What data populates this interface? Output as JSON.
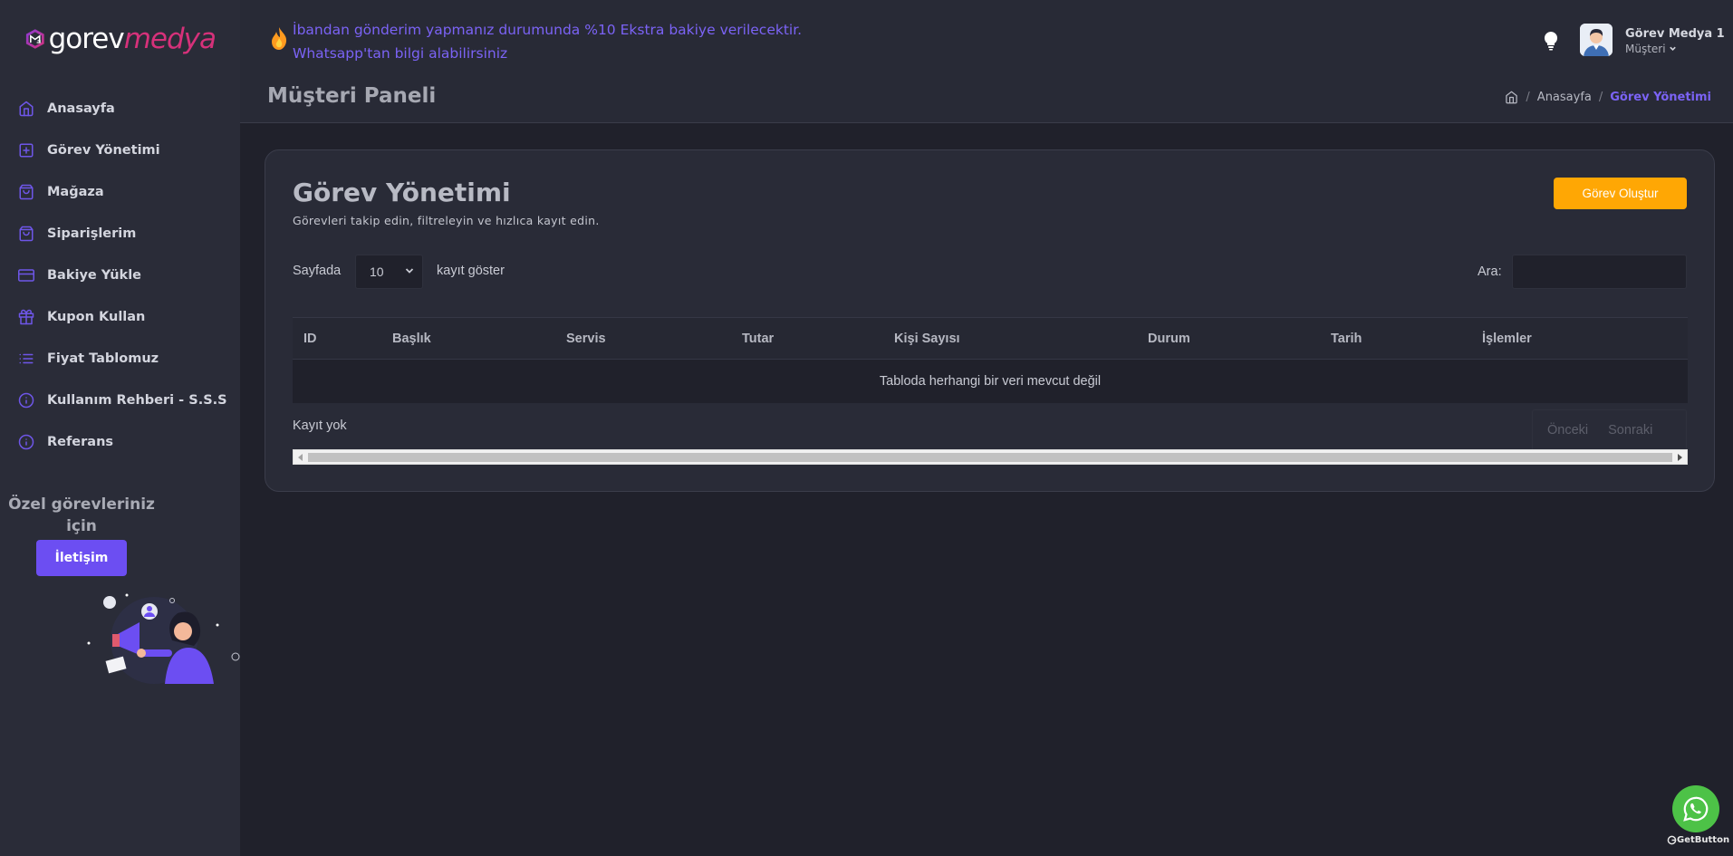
{
  "brand": {
    "logo_part1": "gorev",
    "logo_part2": "medya",
    "accent": "#7b63f5",
    "orange": "#ffa704"
  },
  "sidebar": {
    "items": [
      {
        "label": "Anasayfa",
        "icon": "home-icon"
      },
      {
        "label": "Görev Yönetimi",
        "icon": "plus-square-icon"
      },
      {
        "label": "Mağaza",
        "icon": "shopping-bag-icon"
      },
      {
        "label": "Siparişlerim",
        "icon": "shopping-bag-icon"
      },
      {
        "label": "Bakiye Yükle",
        "icon": "credit-card-icon"
      },
      {
        "label": "Kupon Kullan",
        "icon": "gift-icon"
      },
      {
        "label": "Fiyat Tablomuz",
        "icon": "list-icon"
      },
      {
        "label": "Kullanım Rehberi - S.S.S",
        "icon": "info-icon"
      },
      {
        "label": "Referans",
        "icon": "info-icon"
      }
    ],
    "promo_text": "Özel görevleriniz için",
    "promo_button": "İletişim"
  },
  "header": {
    "announcement": "İbandan gönderim yapmanız durumunda %10 Ekstra bakiye verilecektir. Whatsapp'tan bilgi alabilirsiniz",
    "user_name": "Görev Medya 1",
    "user_role": "Müşteri"
  },
  "page": {
    "title": "Müşteri Paneli",
    "breadcrumb": [
      "Anasayfa",
      "Görev Yönetimi"
    ]
  },
  "card": {
    "title": "Görev Yönetimi",
    "subtitle": "Görevleri takip edin, filtreleyin ve hızlıca kayıt edin.",
    "create_button": "Görev Oluştur"
  },
  "table": {
    "length_label": "Sayfada",
    "length_value": "10",
    "length_suffix": "kayıt göster",
    "search_label": "Ara:",
    "search_value": "",
    "columns": [
      "ID",
      "Başlık",
      "Servis",
      "Tutar",
      "Kişi Sayısı",
      "Durum",
      "Tarih",
      "İşlemler"
    ],
    "empty_message": "Tabloda herhangi bir veri mevcut değil",
    "info": "Kayıt yok",
    "prev": "Önceki",
    "next": "Sonraki"
  },
  "whatsapp": {
    "powered_by": "GetButton"
  }
}
